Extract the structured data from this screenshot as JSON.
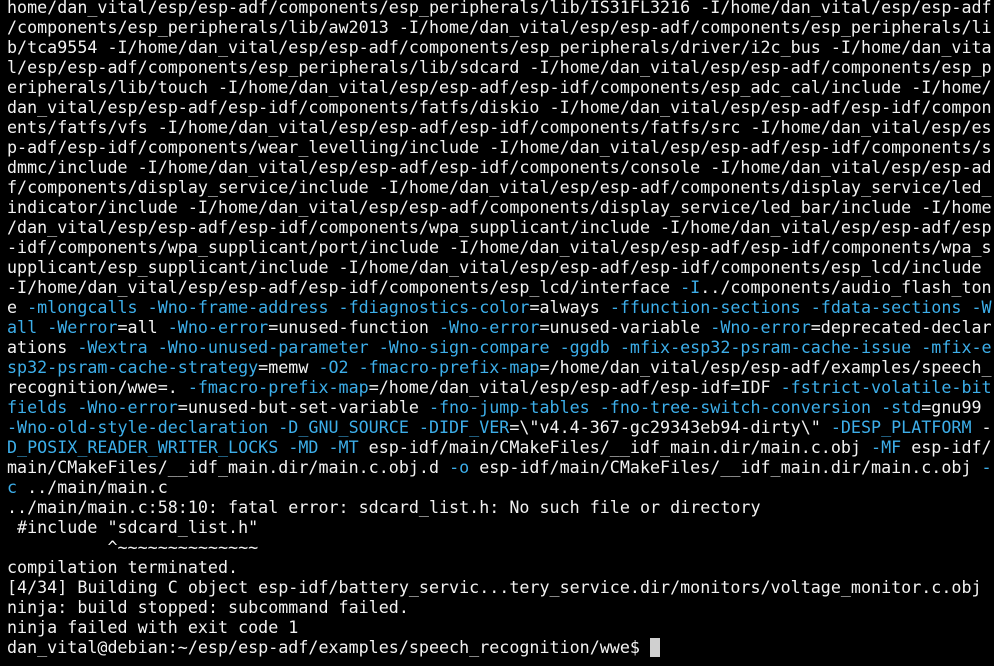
{
  "colors": {
    "background": "#000000",
    "default": "#f2f2f2",
    "flag": "#3daee9",
    "error": "#e0304a",
    "warning": "#f0c020",
    "info": "#3daee9"
  },
  "lines": [
    [
      {
        "t": "home/dan_vital/esp/esp-adf/components/esp_peripherals/lib/IS31FL3216 -I/home/dan_vital/esp/esp-adf",
        "c": "default"
      }
    ],
    [
      {
        "t": "/components/esp_peripherals/lib/aw2013 -I/home/dan_vital/esp/esp-adf/components/esp_peripherals/li",
        "c": "default"
      }
    ],
    [
      {
        "t": "b/tca9554 -I/home/dan_vital/esp/esp-adf/components/esp_peripherals/driver/i2c_bus -I/home/dan_vita",
        "c": "default"
      }
    ],
    [
      {
        "t": "l/esp/esp-adf/components/esp_peripherals/lib/sdcard -I/home/dan_vital/esp/esp-adf/components/esp_p",
        "c": "default"
      }
    ],
    [
      {
        "t": "eripherals/lib/touch -I/home/dan_vital/esp/esp-adf/esp-idf/components/esp_adc_cal/include -I/home/",
        "c": "default"
      }
    ],
    [
      {
        "t": "dan_vital/esp/esp-adf/esp-idf/components/fatfs/diskio -I/home/dan_vital/esp/esp-adf/esp-idf/compon",
        "c": "default"
      }
    ],
    [
      {
        "t": "ents/fatfs/vfs -I/home/dan_vital/esp/esp-adf/esp-idf/components/fatfs/src -I/home/dan_vital/esp/es",
        "c": "default"
      }
    ],
    [
      {
        "t": "p-adf/esp-idf/components/wear_levelling/include -I/home/dan_vital/esp/esp-adf/esp-idf/components/s",
        "c": "default"
      }
    ],
    [
      {
        "t": "dmmc/include -I/home/dan_vital/esp/esp-adf/esp-idf/components/console -I/home/dan_vital/esp/esp-ad",
        "c": "default"
      }
    ],
    [
      {
        "t": "f/components/display_service/include -I/home/dan_vital/esp/esp-adf/components/display_service/led_",
        "c": "default"
      }
    ],
    [
      {
        "t": "indicator/include -I/home/dan_vital/esp/esp-adf/components/display_service/led_bar/include -I/home",
        "c": "default"
      }
    ],
    [
      {
        "t": "/dan_vital/esp/esp-adf/esp-idf/components/wpa_supplicant/include -I/home/dan_vital/esp/esp-adf/esp",
        "c": "default"
      }
    ],
    [
      {
        "t": "-idf/components/wpa_supplicant/port/include -I/home/dan_vital/esp/esp-adf/esp-idf/components/wpa_s",
        "c": "default"
      }
    ],
    [
      {
        "t": "upplicant/esp_supplicant/include -I/home/dan_vital/esp/esp-adf/esp-idf/components/esp_lcd/include ",
        "c": "default"
      }
    ],
    [
      {
        "t": "-I/home/dan_vital/esp/esp-adf/esp-idf/components/esp_lcd/interface ",
        "c": "default"
      },
      {
        "t": "-I",
        "c": "flag"
      },
      {
        "t": "../components/audio_flash_ton",
        "c": "default"
      }
    ],
    [
      {
        "t": "e ",
        "c": "default"
      },
      {
        "t": "-mlongcalls",
        "c": "flag"
      },
      {
        "t": " ",
        "c": "default"
      },
      {
        "t": "-Wno-frame-address",
        "c": "flag"
      },
      {
        "t": " ",
        "c": "default"
      },
      {
        "t": "-fdiagnostics-color",
        "c": "flag"
      },
      {
        "t": "=always ",
        "c": "default"
      },
      {
        "t": "-ffunction-sections",
        "c": "flag"
      },
      {
        "t": " ",
        "c": "default"
      },
      {
        "t": "-fdata-sections",
        "c": "flag"
      },
      {
        "t": " ",
        "c": "default"
      },
      {
        "t": "-W",
        "c": "flag"
      }
    ],
    [
      {
        "t": "all",
        "c": "flag"
      },
      {
        "t": " ",
        "c": "default"
      },
      {
        "t": "-Werror",
        "c": "flag"
      },
      {
        "t": "=all ",
        "c": "default"
      },
      {
        "t": "-Wno-error",
        "c": "flag"
      },
      {
        "t": "=unused-function ",
        "c": "default"
      },
      {
        "t": "-Wno-error",
        "c": "flag"
      },
      {
        "t": "=unused-variable ",
        "c": "default"
      },
      {
        "t": "-Wno-error",
        "c": "flag"
      },
      {
        "t": "=deprecated-declar",
        "c": "default"
      }
    ],
    [
      {
        "t": "ations ",
        "c": "default"
      },
      {
        "t": "-Wextra",
        "c": "flag"
      },
      {
        "t": " ",
        "c": "default"
      },
      {
        "t": "-Wno-unused-parameter",
        "c": "flag"
      },
      {
        "t": " ",
        "c": "default"
      },
      {
        "t": "-Wno-sign-compare",
        "c": "flag"
      },
      {
        "t": " ",
        "c": "default"
      },
      {
        "t": "-ggdb",
        "c": "flag"
      },
      {
        "t": " ",
        "c": "default"
      },
      {
        "t": "-mfix-esp32-psram-cache-issue",
        "c": "flag"
      },
      {
        "t": " ",
        "c": "default"
      },
      {
        "t": "-mfix-e",
        "c": "flag"
      }
    ],
    [
      {
        "t": "sp32-psram-cache-strategy",
        "c": "flag"
      },
      {
        "t": "=memw ",
        "c": "default"
      },
      {
        "t": "-O2",
        "c": "flag"
      },
      {
        "t": " ",
        "c": "default"
      },
      {
        "t": "-fmacro-prefix-map",
        "c": "flag"
      },
      {
        "t": "=/home/dan_vital/esp/esp-adf/examples/speech_",
        "c": "default"
      }
    ],
    [
      {
        "t": "recognition/wwe=. ",
        "c": "default"
      },
      {
        "t": "-fmacro-prefix-map",
        "c": "flag"
      },
      {
        "t": "=/home/dan_vital/esp/esp-adf/esp-idf=IDF ",
        "c": "default"
      },
      {
        "t": "-fstrict-volatile-bit",
        "c": "flag"
      }
    ],
    [
      {
        "t": "fields",
        "c": "flag"
      },
      {
        "t": " ",
        "c": "default"
      },
      {
        "t": "-Wno-error",
        "c": "flag"
      },
      {
        "t": "=unused-but-set-variable ",
        "c": "default"
      },
      {
        "t": "-fno-jump-tables",
        "c": "flag"
      },
      {
        "t": " ",
        "c": "default"
      },
      {
        "t": "-fno-tree-switch-conversion",
        "c": "flag"
      },
      {
        "t": " ",
        "c": "default"
      },
      {
        "t": "-std",
        "c": "flag"
      },
      {
        "t": "=gnu99",
        "c": "default"
      }
    ],
    [
      {
        "t": "-Wno-old-style-declaration",
        "c": "flag"
      },
      {
        "t": " ",
        "c": "default"
      },
      {
        "t": "-D_GNU_SOURCE",
        "c": "flag"
      },
      {
        "t": " ",
        "c": "default"
      },
      {
        "t": "-DIDF_VER",
        "c": "flag"
      },
      {
        "t": "=\\\"v4.4-367-gc29343eb94-dirty\\\" ",
        "c": "default"
      },
      {
        "t": "-DESP_PLATFORM",
        "c": "flag"
      },
      {
        "t": " -",
        "c": "default"
      }
    ],
    [
      {
        "t": "D_POSIX_READER_WRITER_LOCKS",
        "c": "flag"
      },
      {
        "t": " ",
        "c": "default"
      },
      {
        "t": "-MD",
        "c": "flag"
      },
      {
        "t": " ",
        "c": "default"
      },
      {
        "t": "-MT",
        "c": "flag"
      },
      {
        "t": " esp-idf/main/CMakeFiles/__idf_main.dir/main.c.obj ",
        "c": "default"
      },
      {
        "t": "-MF",
        "c": "flag"
      },
      {
        "t": " esp-idf/",
        "c": "default"
      }
    ],
    [
      {
        "t": "main/CMakeFiles/__idf_main.dir/main.c.obj.d ",
        "c": "default"
      },
      {
        "t": "-o",
        "c": "flag"
      },
      {
        "t": " esp-idf/main/CMakeFiles/__idf_main.dir/main.c.obj ",
        "c": "default"
      },
      {
        "t": "-",
        "c": "flag"
      }
    ],
    [
      {
        "t": "c",
        "c": "flag"
      },
      {
        "t": " ../main/main.c",
        "c": "default"
      }
    ],
    [
      {
        "t": "../main/main.c:58:10: ",
        "c": "default"
      },
      {
        "t": "fatal error: ",
        "c": "error"
      },
      {
        "t": "sdcard_list.h: ",
        "c": "default"
      },
      {
        "t": "No",
        "c": "error"
      },
      {
        "t": " such file or directory",
        "c": "default"
      }
    ],
    [
      {
        "t": " #include ",
        "c": "default"
      },
      {
        "t": "\"sdcard_list.h\"",
        "c": "error"
      }
    ],
    [
      {
        "t": "          ^~~~~~~~~~~~~~~",
        "c": "error"
      }
    ],
    [
      {
        "t": "compilation ",
        "c": "default"
      },
      {
        "t": "terminated",
        "c": "warning"
      },
      {
        "t": ".",
        "c": "default"
      }
    ],
    [
      {
        "t": "[4/34] ",
        "c": "default"
      },
      {
        "t": "Building",
        "c": "info"
      },
      {
        "t": " C object esp-idf/battery_servic...tery_service.dir/monitors/voltage_monitor.c.obj",
        "c": "default"
      }
    ],
    [
      {
        "t": "ninja: build ",
        "c": "default"
      },
      {
        "t": "stopped",
        "c": "warning"
      },
      {
        "t": ": subcommand ",
        "c": "default"
      },
      {
        "t": "failed",
        "c": "error"
      },
      {
        "t": ".",
        "c": "default"
      }
    ],
    [
      {
        "t": "ninja ",
        "c": "default"
      },
      {
        "t": "failed",
        "c": "error"
      },
      {
        "t": " with exit code 1",
        "c": "default"
      }
    ],
    [
      {
        "t": "dan_vital@debian:~/esp/esp-adf/examples/speech_recognition/wwe$ ",
        "c": "default"
      }
    ]
  ]
}
